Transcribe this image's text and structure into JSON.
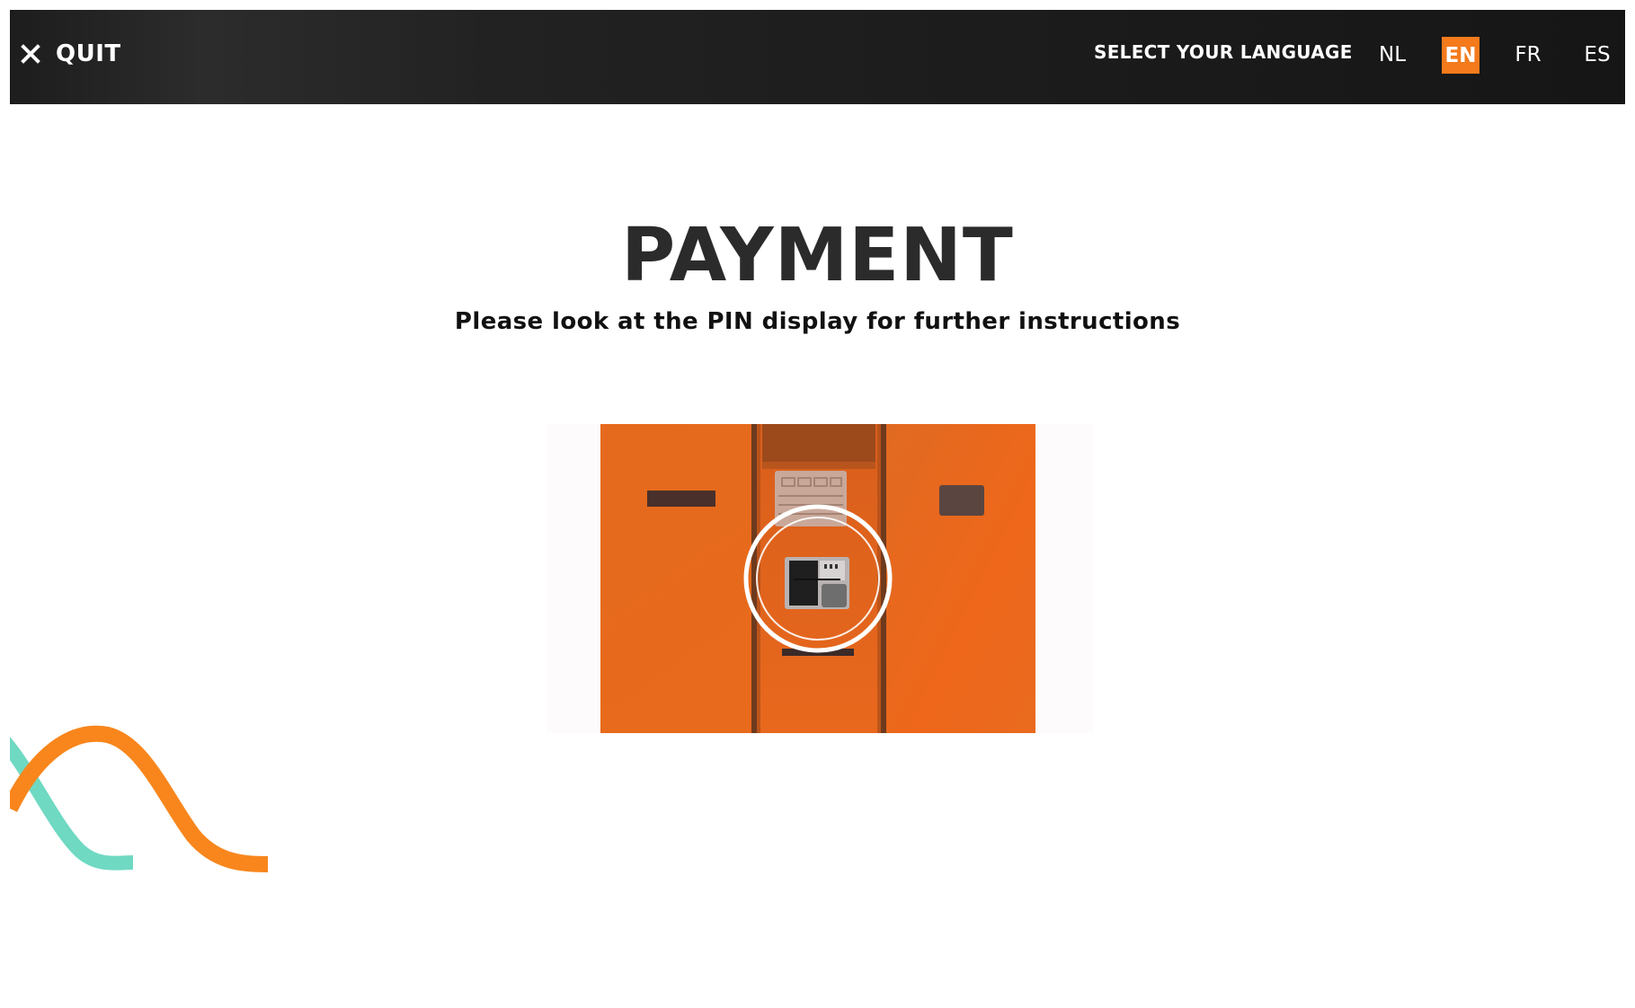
{
  "header": {
    "quit_label": "QUIT",
    "quit_icon": "close-icon",
    "language_heading": "SELECT YOUR LANGUAGE",
    "languages": [
      {
        "code": "NL",
        "active": false
      },
      {
        "code": "EN",
        "active": true
      },
      {
        "code": "FR",
        "active": false
      },
      {
        "code": "ES",
        "active": false
      }
    ],
    "active_color": "#f47a1c",
    "bar_color": "#1d1d1d"
  },
  "main": {
    "title": "PAYMENT",
    "subtitle": "Please look at the PIN display for further instructions",
    "illustration_icon": "payment-terminal-icon"
  },
  "colors": {
    "accent_orange": "#f47a1c",
    "accent_teal": "#6fd9c2",
    "text_dark": "#2b2b2b"
  }
}
